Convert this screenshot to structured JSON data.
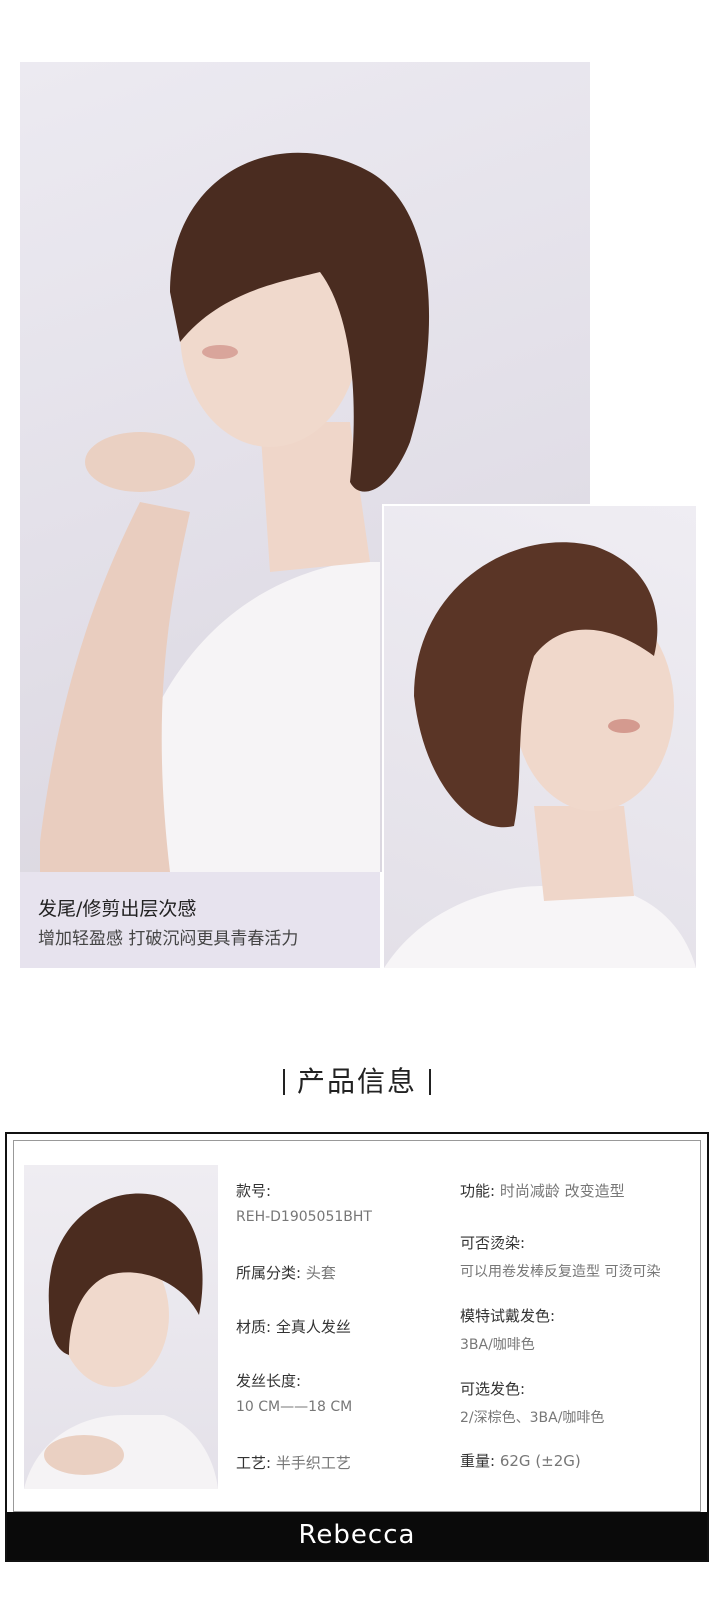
{
  "caption": {
    "title": "发尾/修剪出层次感",
    "subtitle": "增加轻盈感 打破沉闷更具青春活力"
  },
  "section_title": "产品信息",
  "product": {
    "model_label": "款号:",
    "model_value": "REH-D1905051BHT",
    "category_label": "所属分类:",
    "category_value": "头套",
    "material_label": "材质:",
    "material_value": "全真人发丝",
    "length_label": "发丝长度:",
    "length_value": "10 CM——18 CM",
    "craft_label": "工艺:",
    "craft_value": "半手织工艺",
    "function_label": "功能:",
    "function_value": "时尚减龄  改变造型",
    "perm_label": "可否烫染:",
    "perm_value": "可以用卷发棒反复造型 可烫可染",
    "model_color_label": "模特试戴发色:",
    "model_color_value": "3BA/咖啡色",
    "options_label": "可选发色:",
    "options_value": "2/深棕色、3BA/咖啡色",
    "weight_label": "重量:",
    "weight_value": "62G (±2G)"
  },
  "brand": "Rebecca"
}
